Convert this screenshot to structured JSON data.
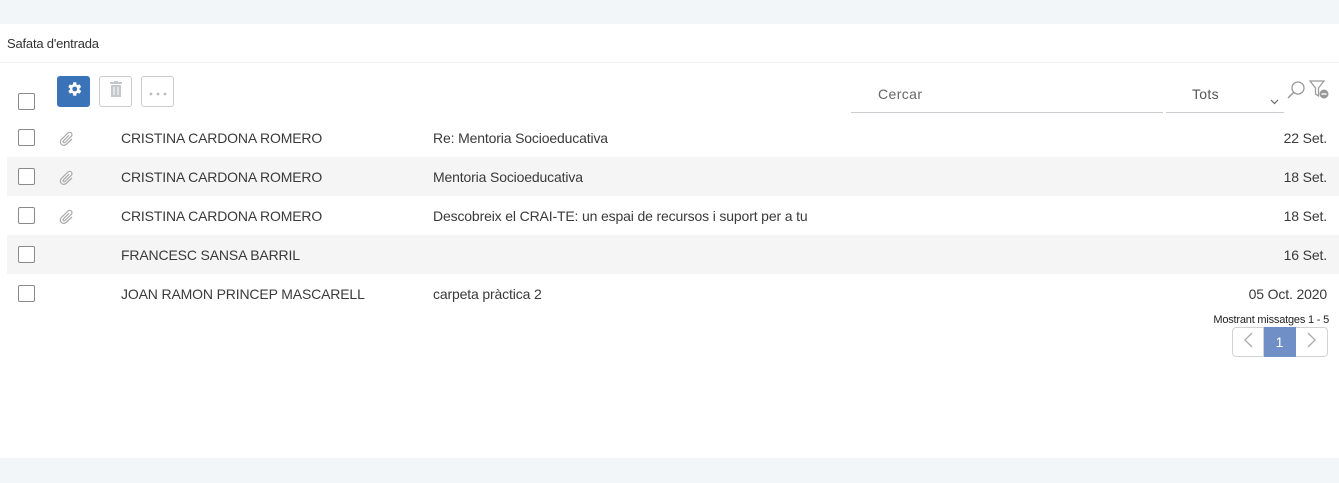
{
  "header": {
    "title": "Safata d'entrada"
  },
  "toolbar": {
    "settings_icon": "gear-icon",
    "delete_icon": "trash-icon",
    "more_icon": "ellipsis-icon",
    "accent_color": "#3b73b9"
  },
  "search": {
    "placeholder": "Cercar",
    "value": ""
  },
  "filter": {
    "selected": "Tots"
  },
  "messages": [
    {
      "sender": "CRISTINA CARDONA ROMERO",
      "subject": "Re: Mentoria Socioeducativa",
      "date": "22 Set.",
      "attachment": true
    },
    {
      "sender": "CRISTINA CARDONA ROMERO",
      "subject": "Mentoria Socioeducativa",
      "date": "18 Set.",
      "attachment": true
    },
    {
      "sender": "CRISTINA CARDONA ROMERO",
      "subject": "Descobreix el CRAI-TE: un espai de recursos i suport per a tu",
      "date": "18 Set.",
      "attachment": true
    },
    {
      "sender": "FRANCESC SANSA BARRIL",
      "subject": "",
      "date": "16 Set.",
      "attachment": false
    },
    {
      "sender": "JOAN RAMON PRINCEP MASCARELL",
      "subject": "carpeta pràctica 2",
      "date": "05 Oct. 2020",
      "attachment": false
    }
  ],
  "pagination": {
    "summary": "Mostrant missatges 1 - 5",
    "current_page": "1"
  }
}
